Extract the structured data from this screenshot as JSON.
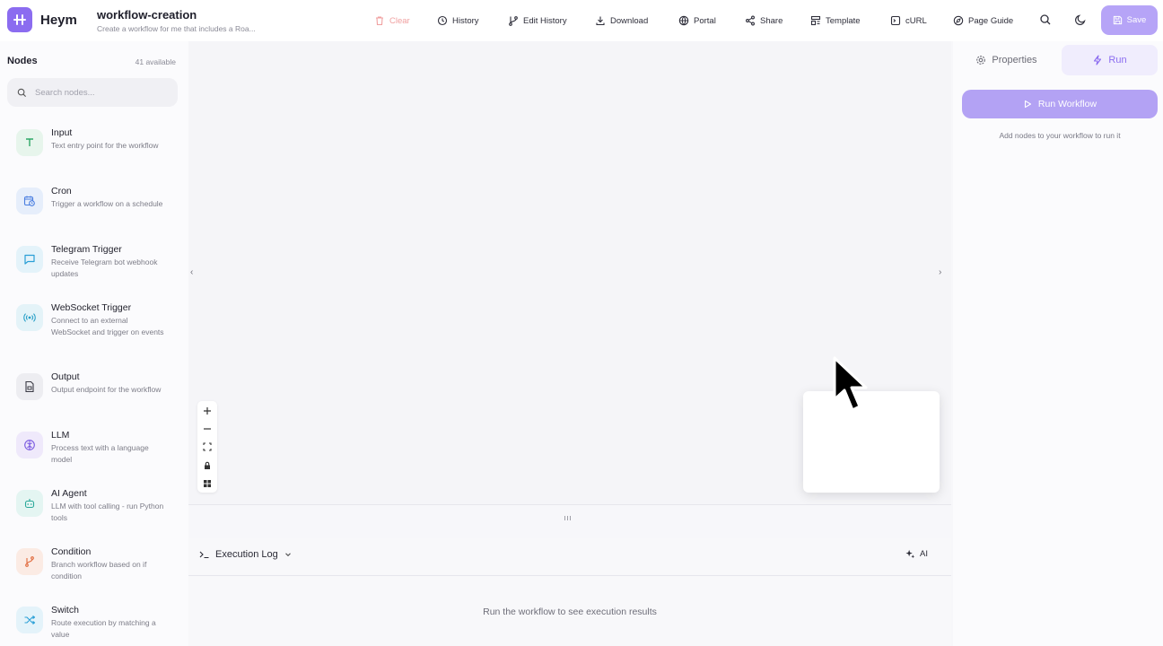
{
  "app": {
    "brand": "Heym"
  },
  "workflow": {
    "title": "workflow-creation",
    "subtitle": "Create a workflow for me that includes a Roa..."
  },
  "toolbar": {
    "clear": "Clear",
    "history": "History",
    "edit_history": "Edit History",
    "download": "Download",
    "portal": "Portal",
    "share": "Share",
    "template": "Template",
    "curl": "cURL",
    "page_guide": "Page Guide",
    "save": "Save"
  },
  "sidebar": {
    "title": "Nodes",
    "count": "41 available",
    "search_placeholder": "Search nodes...",
    "nodes": [
      {
        "name": "Input",
        "desc": "Text entry point for the workflow",
        "icon": "text-icon",
        "color": "#2fa866",
        "bg": "#e7f5ec"
      },
      {
        "name": "Cron",
        "desc": "Trigger a workflow on a schedule",
        "icon": "calendar-clock-icon",
        "color": "#4a7ee0",
        "bg": "#e6eefb"
      },
      {
        "name": "Telegram Trigger",
        "desc": "Receive Telegram bot webhook updates",
        "icon": "message-icon",
        "color": "#2a9fd6",
        "bg": "#e4f3fa"
      },
      {
        "name": "WebSocket Trigger",
        "desc": "Connect to an external WebSocket and trigger on events",
        "icon": "radio-icon",
        "color": "#2aa0c8",
        "bg": "#e4f3f8"
      },
      {
        "name": "Output",
        "desc": "Output endpoint for the workflow",
        "icon": "file-output-icon",
        "color": "#3a3a44",
        "bg": "#ededf1"
      },
      {
        "name": "LLM",
        "desc": "Process text with a language model",
        "icon": "brain-icon",
        "color": "#7a5ae0",
        "bg": "#efe9fb"
      },
      {
        "name": "AI Agent",
        "desc": "LLM with tool calling - run Python tools",
        "icon": "bot-icon",
        "color": "#2aa89a",
        "bg": "#e4f5f2"
      },
      {
        "name": "Condition",
        "desc": "Branch workflow based on if condition",
        "icon": "branch-icon",
        "color": "#e0683a",
        "bg": "#fbebe4"
      },
      {
        "name": "Switch",
        "desc": "Route execution by matching a value",
        "icon": "shuffle-icon",
        "color": "#2a9fd6",
        "bg": "#e4f3fa"
      }
    ]
  },
  "log": {
    "title": "Execution Log",
    "ai_label": "AI",
    "empty": "Run the workflow to see execution results"
  },
  "right_panel": {
    "tab_properties": "Properties",
    "tab_run": "Run",
    "run_button": "Run Workflow",
    "hint": "Add nodes to your workflow to run it"
  },
  "colors": {
    "accent": "#8b6cf0",
    "save_bg": "#b6a4f7"
  }
}
